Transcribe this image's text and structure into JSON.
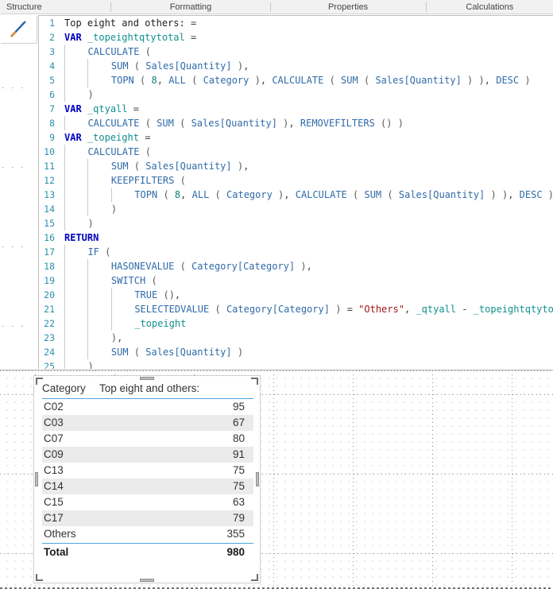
{
  "ribbon": {
    "tabs": [
      {
        "label": "Structure"
      },
      {
        "label": "Formatting"
      },
      {
        "label": "Properties"
      },
      {
        "label": "Calculations"
      }
    ]
  },
  "formula_bar": {
    "icon": "diagonal-pencil-icon",
    "measure_name": "Top eight and others:",
    "lines": [
      {
        "n": "1",
        "indent": 0,
        "guides": 0,
        "tokens": [
          {
            "t": "Top eight and others:",
            "c": "plain"
          },
          {
            "t": " ",
            "c": "plain"
          },
          {
            "t": "=",
            "c": "op"
          }
        ]
      },
      {
        "n": "2",
        "indent": 0,
        "guides": 0,
        "tokens": [
          {
            "t": "VAR",
            "c": "kw"
          },
          {
            "t": " ",
            "c": "plain"
          },
          {
            "t": "_topeightqtytotal",
            "c": "var"
          },
          {
            "t": " ",
            "c": "plain"
          },
          {
            "t": "=",
            "c": "op"
          }
        ]
      },
      {
        "n": "3",
        "indent": 1,
        "guides": 1,
        "tokens": [
          {
            "t": "CALCULATE",
            "c": "fn"
          },
          {
            "t": " ",
            "c": "plain"
          },
          {
            "t": "(",
            "c": "pn"
          }
        ]
      },
      {
        "n": "4",
        "indent": 2,
        "guides": 2,
        "tokens": [
          {
            "t": "SUM",
            "c": "fn"
          },
          {
            "t": " ",
            "c": "plain"
          },
          {
            "t": "(",
            "c": "pn"
          },
          {
            "t": " ",
            "c": "plain"
          },
          {
            "t": "Sales[Quantity]",
            "c": "tbl"
          },
          {
            "t": " ",
            "c": "plain"
          },
          {
            "t": ")",
            "c": "pn"
          },
          {
            "t": ",",
            "c": "op"
          }
        ]
      },
      {
        "n": "5",
        "indent": 2,
        "guides": 2,
        "tokens": [
          {
            "t": "TOPN",
            "c": "fn"
          },
          {
            "t": " ",
            "c": "plain"
          },
          {
            "t": "(",
            "c": "pn"
          },
          {
            "t": " ",
            "c": "plain"
          },
          {
            "t": "8",
            "c": "num"
          },
          {
            "t": ",",
            "c": "op"
          },
          {
            "t": " ",
            "c": "plain"
          },
          {
            "t": "ALL",
            "c": "fn"
          },
          {
            "t": " ",
            "c": "plain"
          },
          {
            "t": "(",
            "c": "pn"
          },
          {
            "t": " ",
            "c": "plain"
          },
          {
            "t": "Category",
            "c": "tbl"
          },
          {
            "t": " ",
            "c": "plain"
          },
          {
            "t": ")",
            "c": "pn"
          },
          {
            "t": ",",
            "c": "op"
          },
          {
            "t": " ",
            "c": "plain"
          },
          {
            "t": "CALCULATE",
            "c": "fn"
          },
          {
            "t": " ",
            "c": "plain"
          },
          {
            "t": "(",
            "c": "pn"
          },
          {
            "t": " ",
            "c": "plain"
          },
          {
            "t": "SUM",
            "c": "fn"
          },
          {
            "t": " ",
            "c": "plain"
          },
          {
            "t": "(",
            "c": "pn"
          },
          {
            "t": " ",
            "c": "plain"
          },
          {
            "t": "Sales[Quantity]",
            "c": "tbl"
          },
          {
            "t": " ",
            "c": "plain"
          },
          {
            "t": ")",
            "c": "pn"
          },
          {
            "t": " ",
            "c": "plain"
          },
          {
            "t": ")",
            "c": "pn"
          },
          {
            "t": ",",
            "c": "op"
          },
          {
            "t": " ",
            "c": "plain"
          },
          {
            "t": "DESC",
            "c": "fn"
          },
          {
            "t": " ",
            "c": "plain"
          },
          {
            "t": ")",
            "c": "pn"
          }
        ]
      },
      {
        "n": "6",
        "indent": 1,
        "guides": 1,
        "tokens": [
          {
            "t": ")",
            "c": "pn"
          }
        ]
      },
      {
        "n": "7",
        "indent": 0,
        "guides": 0,
        "tokens": [
          {
            "t": "VAR",
            "c": "kw"
          },
          {
            "t": " ",
            "c": "plain"
          },
          {
            "t": "_qtyall",
            "c": "var"
          },
          {
            "t": " ",
            "c": "plain"
          },
          {
            "t": "=",
            "c": "op"
          }
        ]
      },
      {
        "n": "8",
        "indent": 1,
        "guides": 1,
        "tokens": [
          {
            "t": "CALCULATE",
            "c": "fn"
          },
          {
            "t": " ",
            "c": "plain"
          },
          {
            "t": "(",
            "c": "pn"
          },
          {
            "t": " ",
            "c": "plain"
          },
          {
            "t": "SUM",
            "c": "fn"
          },
          {
            "t": " ",
            "c": "plain"
          },
          {
            "t": "(",
            "c": "pn"
          },
          {
            "t": " ",
            "c": "plain"
          },
          {
            "t": "Sales[Quantity]",
            "c": "tbl"
          },
          {
            "t": " ",
            "c": "plain"
          },
          {
            "t": ")",
            "c": "pn"
          },
          {
            "t": ",",
            "c": "op"
          },
          {
            "t": " ",
            "c": "plain"
          },
          {
            "t": "REMOVEFILTERS",
            "c": "fn"
          },
          {
            "t": " ",
            "c": "plain"
          },
          {
            "t": "(",
            "c": "pn"
          },
          {
            "t": ")",
            "c": "pn"
          },
          {
            "t": " ",
            "c": "plain"
          },
          {
            "t": ")",
            "c": "pn"
          }
        ]
      },
      {
        "n": "9",
        "indent": 0,
        "guides": 0,
        "tokens": [
          {
            "t": "VAR",
            "c": "kw"
          },
          {
            "t": " ",
            "c": "plain"
          },
          {
            "t": "_topeight",
            "c": "var"
          },
          {
            "t": " ",
            "c": "plain"
          },
          {
            "t": "=",
            "c": "op"
          }
        ]
      },
      {
        "n": "10",
        "indent": 1,
        "guides": 1,
        "tokens": [
          {
            "t": "CALCULATE",
            "c": "fn"
          },
          {
            "t": " ",
            "c": "plain"
          },
          {
            "t": "(",
            "c": "pn"
          }
        ]
      },
      {
        "n": "11",
        "indent": 2,
        "guides": 2,
        "tokens": [
          {
            "t": "SUM",
            "c": "fn"
          },
          {
            "t": " ",
            "c": "plain"
          },
          {
            "t": "(",
            "c": "pn"
          },
          {
            "t": " ",
            "c": "plain"
          },
          {
            "t": "Sales[Quantity]",
            "c": "tbl"
          },
          {
            "t": " ",
            "c": "plain"
          },
          {
            "t": ")",
            "c": "pn"
          },
          {
            "t": ",",
            "c": "op"
          }
        ]
      },
      {
        "n": "12",
        "indent": 2,
        "guides": 2,
        "tokens": [
          {
            "t": "KEEPFILTERS",
            "c": "fn"
          },
          {
            "t": " ",
            "c": "plain"
          },
          {
            "t": "(",
            "c": "pn"
          }
        ]
      },
      {
        "n": "13",
        "indent": 3,
        "guides": 3,
        "tokens": [
          {
            "t": "TOPN",
            "c": "fn"
          },
          {
            "t": " ",
            "c": "plain"
          },
          {
            "t": "(",
            "c": "pn"
          },
          {
            "t": " ",
            "c": "plain"
          },
          {
            "t": "8",
            "c": "num"
          },
          {
            "t": ",",
            "c": "op"
          },
          {
            "t": " ",
            "c": "plain"
          },
          {
            "t": "ALL",
            "c": "fn"
          },
          {
            "t": " ",
            "c": "plain"
          },
          {
            "t": "(",
            "c": "pn"
          },
          {
            "t": " ",
            "c": "plain"
          },
          {
            "t": "Category",
            "c": "tbl"
          },
          {
            "t": " ",
            "c": "plain"
          },
          {
            "t": ")",
            "c": "pn"
          },
          {
            "t": ",",
            "c": "op"
          },
          {
            "t": " ",
            "c": "plain"
          },
          {
            "t": "CALCULATE",
            "c": "fn"
          },
          {
            "t": " ",
            "c": "plain"
          },
          {
            "t": "(",
            "c": "pn"
          },
          {
            "t": " ",
            "c": "plain"
          },
          {
            "t": "SUM",
            "c": "fn"
          },
          {
            "t": " ",
            "c": "plain"
          },
          {
            "t": "(",
            "c": "pn"
          },
          {
            "t": " ",
            "c": "plain"
          },
          {
            "t": "Sales[Quantity]",
            "c": "tbl"
          },
          {
            "t": " ",
            "c": "plain"
          },
          {
            "t": ")",
            "c": "pn"
          },
          {
            "t": " ",
            "c": "plain"
          },
          {
            "t": ")",
            "c": "pn"
          },
          {
            "t": ",",
            "c": "op"
          },
          {
            "t": " ",
            "c": "plain"
          },
          {
            "t": "DESC",
            "c": "fn"
          },
          {
            "t": " ",
            "c": "plain"
          },
          {
            "t": ")",
            "c": "pn"
          }
        ]
      },
      {
        "n": "14",
        "indent": 2,
        "guides": 2,
        "tokens": [
          {
            "t": ")",
            "c": "pn"
          }
        ]
      },
      {
        "n": "15",
        "indent": 1,
        "guides": 1,
        "tokens": [
          {
            "t": ")",
            "c": "pn"
          }
        ]
      },
      {
        "n": "16",
        "indent": 0,
        "guides": 0,
        "tokens": [
          {
            "t": "RETURN",
            "c": "kw"
          }
        ]
      },
      {
        "n": "17",
        "indent": 1,
        "guides": 1,
        "tokens": [
          {
            "t": "IF",
            "c": "fn"
          },
          {
            "t": " ",
            "c": "plain"
          },
          {
            "t": "(",
            "c": "pn"
          }
        ]
      },
      {
        "n": "18",
        "indent": 2,
        "guides": 2,
        "tokens": [
          {
            "t": "HASONEVALUE",
            "c": "fn"
          },
          {
            "t": " ",
            "c": "plain"
          },
          {
            "t": "(",
            "c": "pn"
          },
          {
            "t": " ",
            "c": "plain"
          },
          {
            "t": "Category[Category]",
            "c": "tbl"
          },
          {
            "t": " ",
            "c": "plain"
          },
          {
            "t": ")",
            "c": "pn"
          },
          {
            "t": ",",
            "c": "op"
          }
        ]
      },
      {
        "n": "19",
        "indent": 2,
        "guides": 2,
        "tokens": [
          {
            "t": "SWITCH",
            "c": "fn"
          },
          {
            "t": " ",
            "c": "plain"
          },
          {
            "t": "(",
            "c": "pn"
          }
        ]
      },
      {
        "n": "20",
        "indent": 3,
        "guides": 3,
        "tokens": [
          {
            "t": "TRUE",
            "c": "fn"
          },
          {
            "t": " ",
            "c": "plain"
          },
          {
            "t": "(",
            "c": "pn"
          },
          {
            "t": ")",
            "c": "pn"
          },
          {
            "t": ",",
            "c": "op"
          }
        ]
      },
      {
        "n": "21",
        "indent": 3,
        "guides": 3,
        "tokens": [
          {
            "t": "SELECTEDVALUE",
            "c": "fn"
          },
          {
            "t": " ",
            "c": "plain"
          },
          {
            "t": "(",
            "c": "pn"
          },
          {
            "t": " ",
            "c": "plain"
          },
          {
            "t": "Category[Category]",
            "c": "tbl"
          },
          {
            "t": " ",
            "c": "plain"
          },
          {
            "t": ")",
            "c": "pn"
          },
          {
            "t": " ",
            "c": "plain"
          },
          {
            "t": "=",
            "c": "op"
          },
          {
            "t": " ",
            "c": "plain"
          },
          {
            "t": "\"Others\"",
            "c": "str"
          },
          {
            "t": ",",
            "c": "op"
          },
          {
            "t": " ",
            "c": "plain"
          },
          {
            "t": "_qtyall",
            "c": "var"
          },
          {
            "t": " ",
            "c": "plain"
          },
          {
            "t": "-",
            "c": "op"
          },
          {
            "t": " ",
            "c": "plain"
          },
          {
            "t": "_topeightqtytotal",
            "c": "var"
          },
          {
            "t": ",",
            "c": "op"
          }
        ]
      },
      {
        "n": "22",
        "indent": 3,
        "guides": 3,
        "tokens": [
          {
            "t": "_topeight",
            "c": "var"
          }
        ]
      },
      {
        "n": "23",
        "indent": 2,
        "guides": 2,
        "tokens": [
          {
            "t": ")",
            "c": "pn"
          },
          {
            "t": ",",
            "c": "op"
          }
        ]
      },
      {
        "n": "24",
        "indent": 2,
        "guides": 2,
        "tokens": [
          {
            "t": "SUM",
            "c": "fn"
          },
          {
            "t": " ",
            "c": "plain"
          },
          {
            "t": "(",
            "c": "pn"
          },
          {
            "t": " ",
            "c": "plain"
          },
          {
            "t": "Sales[Quantity]",
            "c": "tbl"
          },
          {
            "t": " ",
            "c": "plain"
          },
          {
            "t": ")",
            "c": "pn"
          }
        ]
      },
      {
        "n": "25",
        "indent": 1,
        "guides": 1,
        "tokens": [
          {
            "t": ")",
            "c": "pn"
          }
        ]
      }
    ]
  },
  "visual": {
    "type": "table",
    "columns": [
      "Category",
      "Top eight and others:"
    ],
    "rows": [
      {
        "category": "C02",
        "value": "95"
      },
      {
        "category": "C03",
        "value": "67"
      },
      {
        "category": "C07",
        "value": "80"
      },
      {
        "category": "C09",
        "value": "91"
      },
      {
        "category": "C13",
        "value": "75"
      },
      {
        "category": "C14",
        "value": "75"
      },
      {
        "category": "C15",
        "value": "63"
      },
      {
        "category": "C17",
        "value": "79"
      },
      {
        "category": "Others",
        "value": "355"
      }
    ],
    "total": {
      "label": "Total",
      "value": "980"
    }
  },
  "chart_data": {
    "type": "table",
    "title": "Top eight and others:",
    "categories": [
      "C02",
      "C03",
      "C07",
      "C09",
      "C13",
      "C14",
      "C15",
      "C17",
      "Others"
    ],
    "values": [
      95,
      67,
      80,
      91,
      75,
      75,
      63,
      79,
      355
    ],
    "xlabel": "Category",
    "ylabel": "Top eight and others:",
    "total": 980,
    "legend": "none",
    "grid": false
  },
  "colors": {
    "accent": "#4da6e0",
    "keyword": "#0000c0",
    "function": "#2f6ba8",
    "variable": "#128f8f",
    "string": "#a31515",
    "line_number": "#2b91af",
    "alt_row": "#ebebeb"
  }
}
